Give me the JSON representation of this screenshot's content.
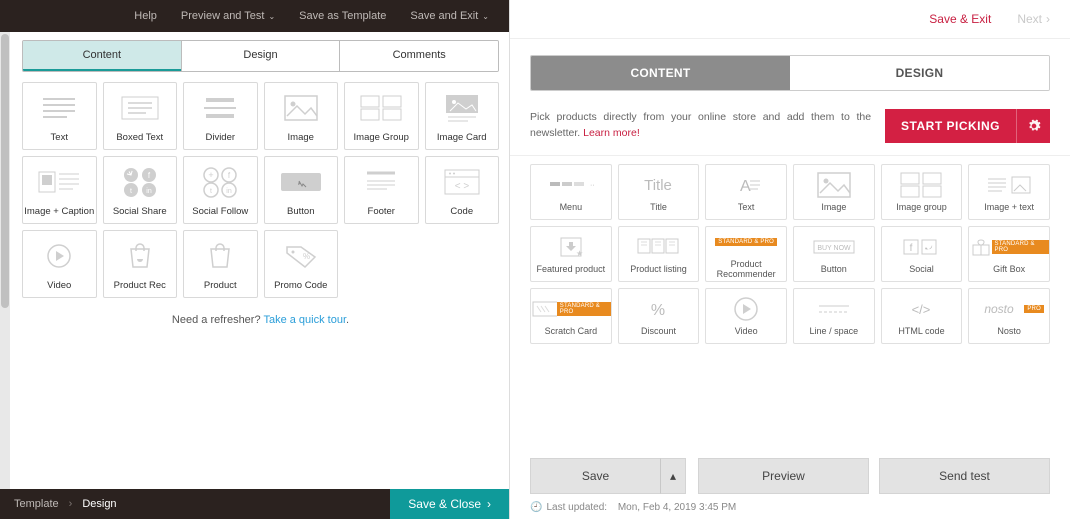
{
  "left": {
    "topbar": [
      "Help",
      "Preview and Test",
      "Save as Template",
      "Save and Exit"
    ],
    "topbar_has_dropdown": [
      false,
      true,
      false,
      true
    ],
    "tabs": [
      "Content",
      "Design",
      "Comments"
    ],
    "tiles": [
      {
        "label": "Text",
        "icon": "lines"
      },
      {
        "label": "Boxed Text",
        "icon": "boxed-lines"
      },
      {
        "label": "Divider",
        "icon": "divider"
      },
      {
        "label": "Image",
        "icon": "image"
      },
      {
        "label": "Image Group",
        "icon": "image-group"
      },
      {
        "label": "Image Card",
        "icon": "image-card"
      },
      {
        "label": "Image + Caption",
        "icon": "image-caption"
      },
      {
        "label": "Social Share",
        "icon": "social-share"
      },
      {
        "label": "Social Follow",
        "icon": "social-follow"
      },
      {
        "label": "Button",
        "icon": "button"
      },
      {
        "label": "Footer",
        "icon": "footer"
      },
      {
        "label": "Code",
        "icon": "code"
      },
      {
        "label": "Video",
        "icon": "video"
      },
      {
        "label": "Product Rec",
        "icon": "product-rec"
      },
      {
        "label": "Product",
        "icon": "product"
      },
      {
        "label": "Promo Code",
        "icon": "promo"
      }
    ],
    "refresher_text": "Need a refresher? ",
    "refresher_link": "Take a quick tour",
    "breadcrumb": {
      "root": "Template",
      "current": "Design"
    },
    "save_close": "Save & Close"
  },
  "right": {
    "save_exit": "Save & Exit",
    "next": "Next",
    "tabs": [
      "CONTENT",
      "DESIGN"
    ],
    "picker_text": "Pick products directly from your online store and add them to the newsletter. ",
    "picker_link": "Learn more!",
    "start_picking": "START PICKING",
    "tiles": [
      {
        "label": "Menu",
        "icon": "menu"
      },
      {
        "label": "Title",
        "icon": "title"
      },
      {
        "label": "Text",
        "icon": "text-a"
      },
      {
        "label": "Image",
        "icon": "image"
      },
      {
        "label": "Image group",
        "icon": "image-group"
      },
      {
        "label": "Image + text",
        "icon": "image-text"
      },
      {
        "label": "Featured product",
        "icon": "featured"
      },
      {
        "label": "Product listing",
        "icon": "listing"
      },
      {
        "label": "Product Recommender",
        "icon": "recommender",
        "badge": "STANDARD & PRO"
      },
      {
        "label": "Button",
        "icon": "buy"
      },
      {
        "label": "Social",
        "icon": "social"
      },
      {
        "label": "Gift Box",
        "icon": "gift",
        "badge": "STANDARD & PRO"
      },
      {
        "label": "Scratch Card",
        "icon": "scratch",
        "badge": "STANDARD & PRO"
      },
      {
        "label": "Discount",
        "icon": "discount"
      },
      {
        "label": "Video",
        "icon": "video"
      },
      {
        "label": "Line / space",
        "icon": "line"
      },
      {
        "label": "HTML code",
        "icon": "html"
      },
      {
        "label": "Nosto",
        "icon": "nosto",
        "badge": "PRO"
      }
    ],
    "footer_btns": {
      "save": "Save",
      "preview": "Preview",
      "send": "Send test"
    },
    "updated_label": "Last updated:",
    "updated_value": "Mon, Feb 4, 2019 3:45 PM"
  }
}
